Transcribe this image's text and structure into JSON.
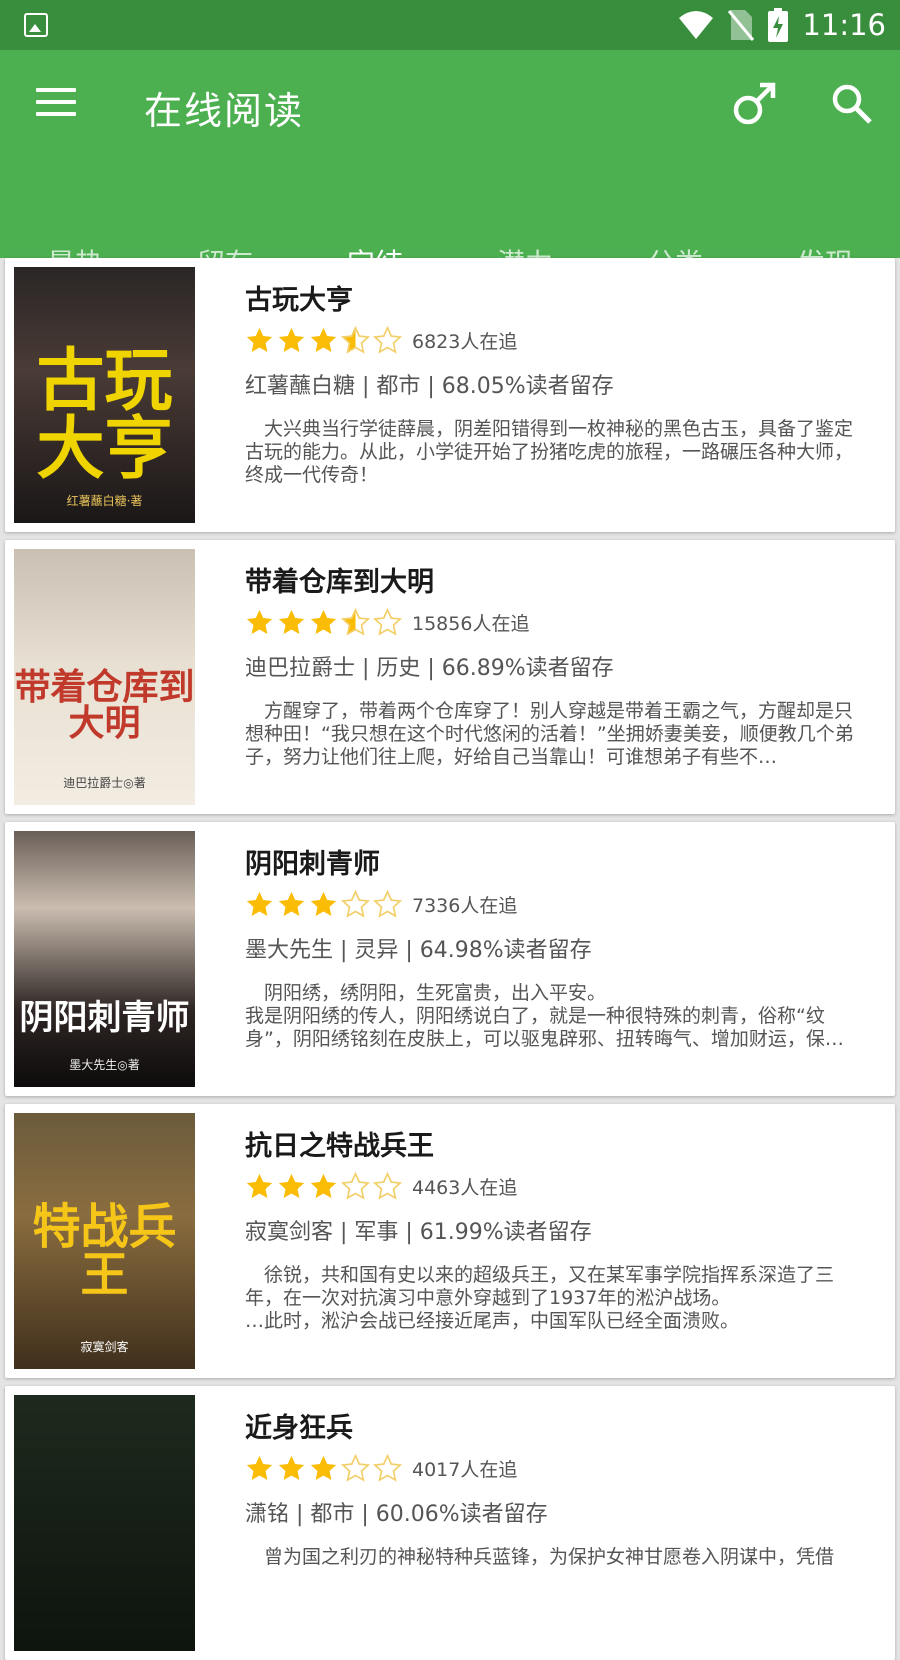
{
  "status_bar": {
    "time": "11:16"
  },
  "app_bar": {
    "title": "在线阅读"
  },
  "tabs": [
    {
      "label": "最热",
      "active": false
    },
    {
      "label": "留存",
      "active": false
    },
    {
      "label": "完结",
      "active": true
    },
    {
      "label": "潜力",
      "active": false
    },
    {
      "label": "分类",
      "active": false
    },
    {
      "label": "发现",
      "active": false
    }
  ],
  "colors": {
    "primary": "#4caf50",
    "primary_dark": "#388e3c",
    "star": "#fbbc05",
    "star_empty": "#f3cf6a"
  },
  "books": [
    {
      "title": "古玩大亨",
      "rating": 3.5,
      "followers": "6823人在追",
      "meta": "红薯蘸白糖 | 都市 | 68.05%读者留存",
      "desc": "　大兴典当行学徒薛晨，阴差阳错得到一枚神秘的黑色古玉，具备了鉴定古玩的能力。从此，小学徒开始了扮猪吃虎的旅程，一路碾压各种大师，终成一代传奇！",
      "cover_text": "古玩大亨",
      "cover_author": "红薯蘸白糖·著"
    },
    {
      "title": "带着仓库到大明",
      "rating": 3.5,
      "followers": "15856人在追",
      "meta": "迪巴拉爵士 | 历史 | 66.89%读者留存",
      "desc": "　方醒穿了，带着两个仓库穿了！别人穿越是带着王霸之气，方醒却是只想种田！“我只想在这个时代悠闲的活着！”坐拥娇妻美妾，顺便教几个弟子，努力让他们往上爬，好给自己当靠山！可谁想弟子有些不…",
      "cover_text": "带着仓库到大明",
      "cover_author": "迪巴拉爵士◎著"
    },
    {
      "title": "阴阳刺青师",
      "rating": 3,
      "followers": "7336人在追",
      "meta": "墨大先生 | 灵异 | 64.98%读者留存",
      "desc": "　阴阳绣，绣阴阳，生死富贵，出入平安。\n我是阴阳绣的传人，阴阳绣说白了，就是一种很特殊的刺青，俗称“纹身”，阴阳绣铭刻在皮肤上，可以驱鬼辟邪、扭转晦气、增加财运，保…",
      "cover_text": "阴阳刺青师",
      "cover_author": "墨大先生◎著"
    },
    {
      "title": "抗日之特战兵王",
      "rating": 3,
      "followers": "4463人在追",
      "meta": "寂寞剑客 | 军事 | 61.99%读者留存",
      "desc": "　徐锐，共和国有史以来的超级兵王，又在某军事学院指挥系深造了三年，在一次对抗演习中意外穿越到了1937年的淞沪战场。\n…此时，淞沪会战已经接近尾声，中国军队已经全面溃败。",
      "cover_text": "特战兵王",
      "cover_author": "寂寞剑客"
    },
    {
      "title": "近身狂兵",
      "rating": 3,
      "followers": "4017人在追",
      "meta": "潇铭 | 都市 | 60.06%读者留存",
      "desc": "　曾为国之利刃的神秘特种兵蓝锋，为保护女神甘愿卷入阴谋中，凭借",
      "cover_text": "",
      "cover_author": ""
    }
  ]
}
